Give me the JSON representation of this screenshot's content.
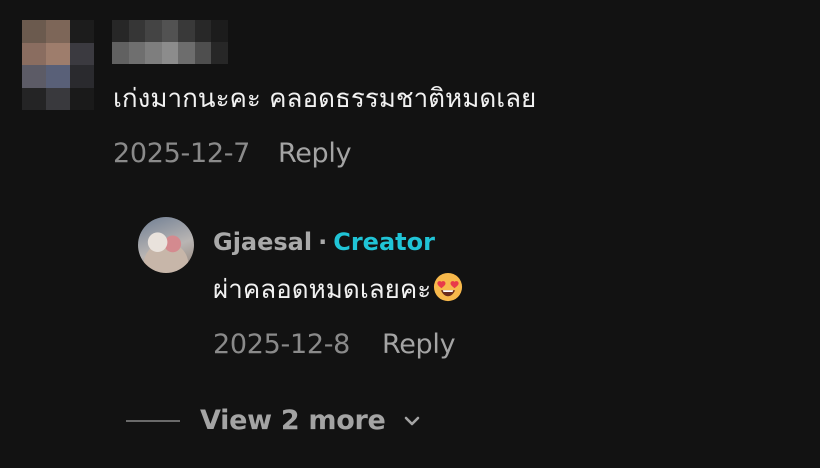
{
  "comment": {
    "avatar_blurred": true,
    "username_blurred": true,
    "text": "เก่งมากนะคะ คลอดธรรมชาติหมดเลย",
    "date": "2025-12-7",
    "reply_label": "Reply"
  },
  "reply": {
    "username": "Gjaesal",
    "separator": "·",
    "badge": "Creator",
    "text": "ผ่าคลอดหมดเลยคะ",
    "emoji": "smiling-face-with-heart-eyes",
    "date": "2025-12-8",
    "reply_label": "Reply"
  },
  "view_more": {
    "label": "View 2 more",
    "icon": "chevron-down-icon"
  },
  "colors": {
    "background": "#121212",
    "text": "#f1f1f1",
    "muted": "#8a8a8a",
    "creator_badge": "#20c4d6"
  }
}
